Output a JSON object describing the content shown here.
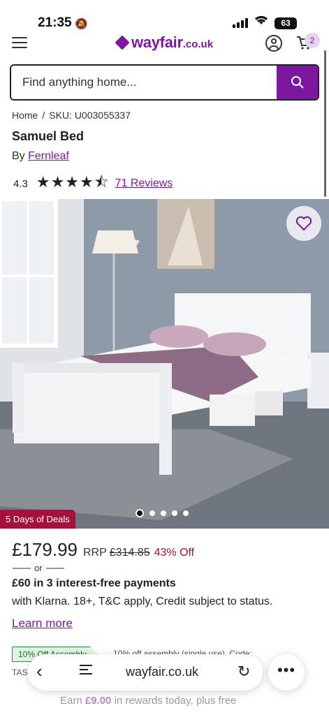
{
  "status_bar": {
    "time": "21:35",
    "battery": "63"
  },
  "header": {
    "logo_text": "wayfair",
    "logo_suffix": ".co.uk",
    "cart_count": "2",
    "brand_color": "#7b189f"
  },
  "search": {
    "placeholder": "Find anything home..."
  },
  "breadcrumb": {
    "home": "Home",
    "separator": "/",
    "sku": "SKU: U003055337"
  },
  "product": {
    "title": "Samuel Bed",
    "by_prefix": "By",
    "brand": "Fernleaf",
    "rating": "4.3",
    "stars": "★★★★⯪",
    "rating_value": 4.3,
    "reviews": "71 Reviews"
  },
  "gallery": {
    "deal_badge": "5 Days of Deals",
    "image_count": 5,
    "active_index": 0
  },
  "pricing": {
    "price": "£179.99",
    "rrp_label": "RRP",
    "rrp_value": "£314.85",
    "discount": "43% Off",
    "or_text": "or",
    "installments": "£60 in 3 interest-free payments",
    "klarna_terms": "with Klarna. 18+, T&C apply, Credit subject to status.",
    "learn_more": "Learn more",
    "discount_color": "#a3123a"
  },
  "assembly": {
    "tag": "10% Off Assembly",
    "text": "10% off assembly (single use). Code:",
    "code_prefix": "TAS"
  },
  "rewards": {
    "prefix": "Earn",
    "amount": "£9.00",
    "suffix": "in rewards today, plus free"
  },
  "browser": {
    "url": "wayfair.co.uk"
  }
}
